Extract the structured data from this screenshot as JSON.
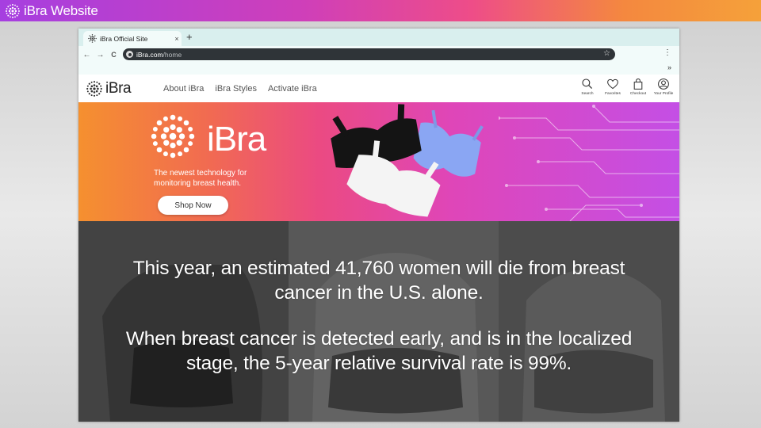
{
  "slide": {
    "title": "iBra Website",
    "logo_icon": "ibra-dot-logo-icon"
  },
  "browser": {
    "tab_title": "iBra Official Site",
    "close_glyph": "×",
    "new_tab_glyph": "+",
    "back_glyph": "←",
    "forward_glyph": "→",
    "reload_glyph": "C",
    "url_host": "iBra.com",
    "url_path": "/home",
    "star_glyph": "☆",
    "menu_glyph": "⋮",
    "more_glyph": "»"
  },
  "site": {
    "brand": "iBra",
    "nav_links": [
      "About iBra",
      "iBra Styles",
      "Activate iBra"
    ],
    "icons": [
      {
        "icon": "search-icon",
        "label": "Search"
      },
      {
        "icon": "heart-icon",
        "label": "Favorites"
      },
      {
        "icon": "shopping-bag-icon",
        "label": "Checkout"
      },
      {
        "icon": "user-icon",
        "label": "Your Profile"
      }
    ]
  },
  "hero": {
    "brand": "iBra",
    "tagline": "The newest technology for monitoring breast health.",
    "cta": "Shop Now"
  },
  "info": {
    "line1": "This year, an estimated 41,760 women will die from breast cancer in the U.S. alone.",
    "line2": "When breast cancer is detected early, and is in the localized stage, the 5-year relative survival rate is 99%."
  },
  "colors": {
    "gradient_start": "#f5902f",
    "gradient_mid": "#eb4a82",
    "gradient_end": "#c44fe5",
    "url_bar": "#2f3438",
    "tab_strip": "#d9efee"
  }
}
